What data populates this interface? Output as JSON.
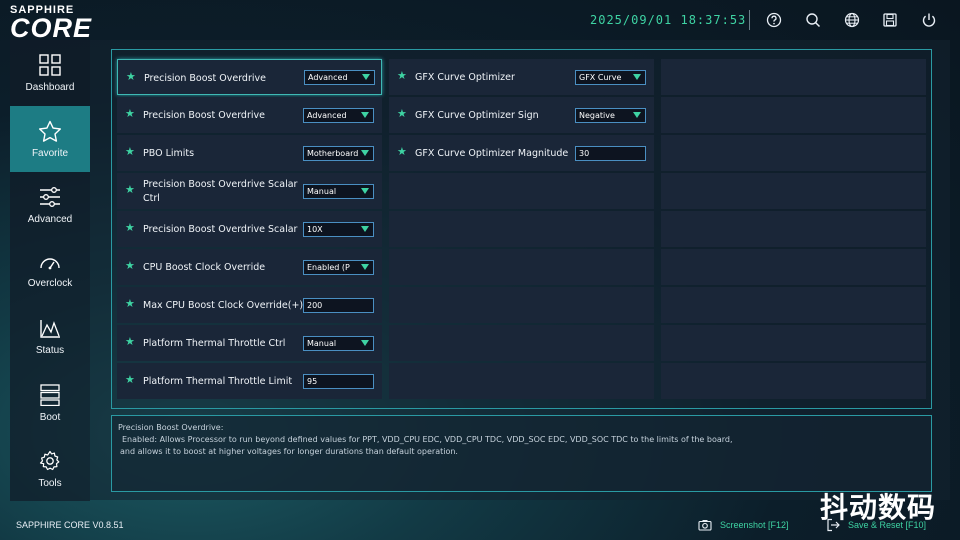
{
  "app": {
    "brand_small": "SAPPHIRE",
    "brand_big": "CORE",
    "datetime": "2025/09/01 18:37:53",
    "version": "SAPPHIRE CORE V0.8.51"
  },
  "top_icons": [
    "help-icon",
    "search-icon",
    "globe-icon",
    "save-icon",
    "power-icon"
  ],
  "sidebar": {
    "items": [
      {
        "label": "Dashboard",
        "icon": "dashboard-icon"
      },
      {
        "label": "Favorite",
        "icon": "star-icon",
        "active": true
      },
      {
        "label": "Advanced",
        "icon": "sliders-icon"
      },
      {
        "label": "Overclock",
        "icon": "gauge-icon"
      },
      {
        "label": "Status",
        "icon": "chart-icon"
      },
      {
        "label": "Boot",
        "icon": "boot-icon"
      },
      {
        "label": "Tools",
        "icon": "gear-icon"
      }
    ]
  },
  "settings_left": [
    {
      "label": "Precision Boost Overdrive",
      "value": "Advanced",
      "type": "select"
    },
    {
      "label": "Precision Boost Overdrive",
      "value": "Advanced",
      "type": "select"
    },
    {
      "label": "PBO Limits",
      "value": "Motherboard",
      "type": "select"
    },
    {
      "label_line1": "Precision Boost Overdrive Scalar",
      "label_line2": "Ctrl",
      "value": "Manual",
      "type": "select"
    },
    {
      "label": "Precision Boost Overdrive Scalar",
      "value": "10X",
      "type": "select"
    },
    {
      "label": "CPU Boost Clock Override",
      "value": "Enabled (P",
      "type": "select"
    },
    {
      "label": "Max CPU Boost Clock Override(+)",
      "value": "200",
      "type": "input"
    },
    {
      "label": "Platform Thermal Throttle Ctrl",
      "value": "Manual",
      "type": "select"
    },
    {
      "label": "Platform Thermal Throttle Limit",
      "value": "95",
      "type": "input"
    }
  ],
  "settings_mid": [
    {
      "label": "GFX Curve Optimizer",
      "value": "GFX Curve",
      "type": "select"
    },
    {
      "label": "GFX Curve Optimizer Sign",
      "value": "Negative",
      "type": "select"
    },
    {
      "label": "GFX Curve Optimizer Magnitude",
      "value": "30",
      "type": "input"
    }
  ],
  "description": {
    "title": "Precision Boost Overdrive:",
    "line1": "Enabled: Allows Processor to run beyond defined values for PPT, VDD_CPU EDC, VDD_CPU TDC, VDD_SOC EDC, VDD_SOC TDC to the limits of the board,",
    "line2": "and allows it to boost at higher voltages for longer durations than default operation."
  },
  "footer": {
    "screenshot_label": "Screenshot [F12]",
    "save_label": "Save & Reset [F10]"
  },
  "watermark": "抖动数码",
  "colors": {
    "accent": "#3ed3a3",
    "active_nav": "#1d7c84",
    "border": "#2a9aa3"
  }
}
